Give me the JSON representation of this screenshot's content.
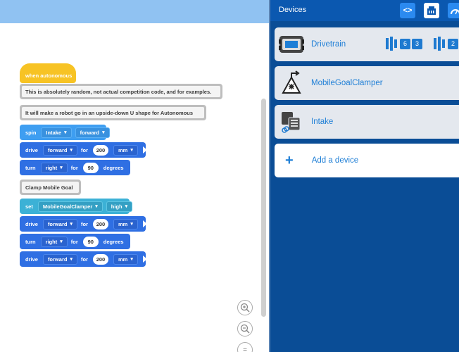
{
  "workspace": {
    "blocks": {
      "hat": "when autonomous",
      "comment1": "This is absolutely random, not actual competition code, and for examples.",
      "comment2": "It will make a robot go in an upside-down U shape for Autonomous",
      "spin": {
        "verb": "spin",
        "motor": "Intake",
        "dir": "forward"
      },
      "drive1": {
        "verb": "drive",
        "dir": "forward",
        "for": "for",
        "amount": "200",
        "unit": "mm"
      },
      "turn1": {
        "verb": "turn",
        "dir": "right",
        "for": "for",
        "amount": "90",
        "unit": "degrees"
      },
      "comment3": "Clamp Mobile Goal",
      "set": {
        "verb": "set",
        "device": "MobileGoalClamper",
        "state": "high"
      },
      "drive2": {
        "verb": "drive",
        "dir": "forward",
        "for": "for",
        "amount": "200",
        "unit": "mm"
      },
      "turn2": {
        "verb": "turn",
        "dir": "right",
        "for": "for",
        "amount": "90",
        "unit": "degrees"
      },
      "drive3": {
        "verb": "drive",
        "dir": "forward",
        "for": "for",
        "amount": "200",
        "unit": "mm"
      }
    },
    "zoom": {
      "zoom_in_icon": "zoom-in-icon",
      "zoom_out_icon": "zoom-out-icon",
      "reset_icon": "zoom-reset-icon"
    }
  },
  "panel": {
    "title": "Devices",
    "toolbar_icons": [
      "code-icon",
      "brain-port-icon",
      "dashboard-icon"
    ],
    "devices": [
      {
        "label": "Drivetrain",
        "icon": "drivetrain-icon",
        "ports": [
          "6",
          "3",
          "2"
        ]
      },
      {
        "label": "MobileGoalClamper",
        "icon": "pneumatic-icon"
      },
      {
        "label": "Intake",
        "icon": "motor-group-icon"
      }
    ],
    "add_label": "Add a device"
  },
  "colors": {
    "hat": "#f7c324",
    "blue": "#2f6fe3",
    "teal": "#3cb1d6",
    "panel": "#0a4d96",
    "accent": "#1f7fd6"
  }
}
